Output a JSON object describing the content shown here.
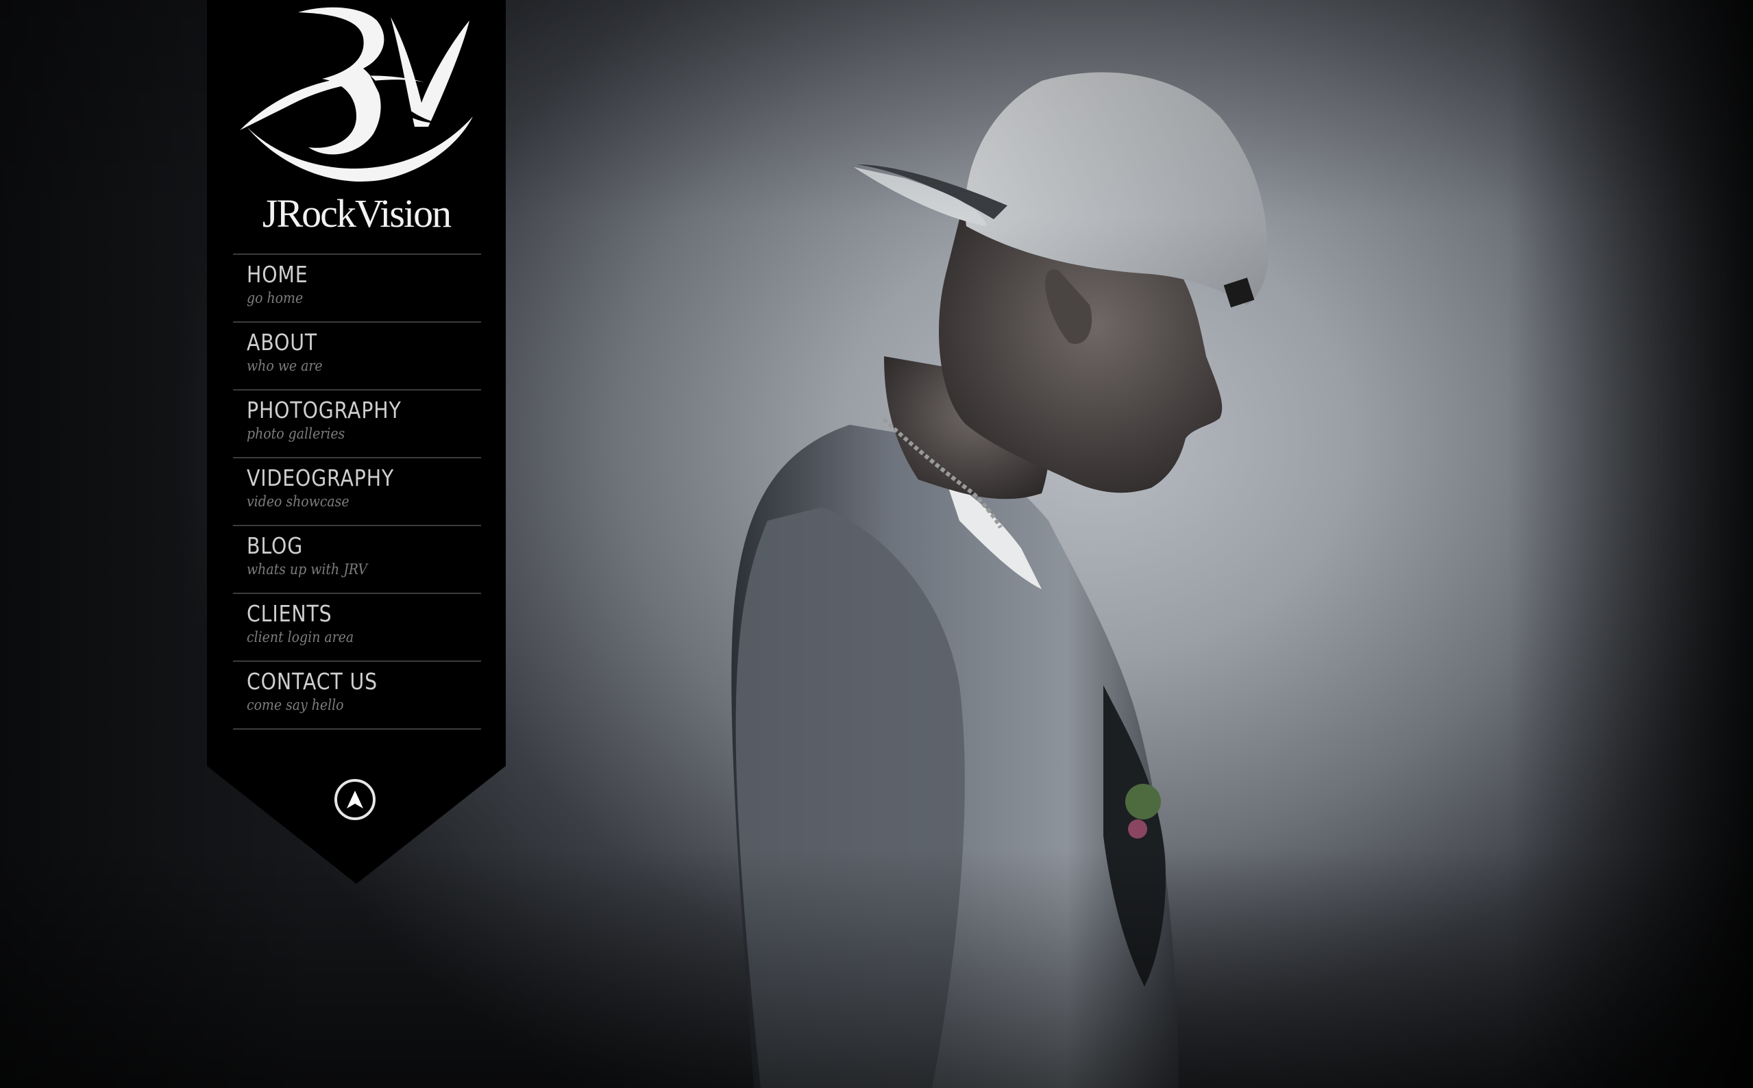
{
  "site": {
    "logo_monogram": "JRV",
    "brand_name": "JRockVision"
  },
  "nav": {
    "items": [
      {
        "label": "HOME",
        "sub": "go home"
      },
      {
        "label": "ABOUT",
        "sub": "who we are"
      },
      {
        "label": "PHOTOGRAPHY",
        "sub": "photo galleries"
      },
      {
        "label": "VIDEOGRAPHY",
        "sub": "video showcase"
      },
      {
        "label": "BLOG",
        "sub": "whats up with JRV"
      },
      {
        "label": "CLIENTS",
        "sub": "client login area"
      },
      {
        "label": "CONTACT US",
        "sub": "come say hello"
      }
    ],
    "up_icon": "navigation-arrow-icon"
  },
  "colors": {
    "banner_bg": "#000000",
    "menu_label": "#cfcfcf",
    "menu_sub": "#7d7d7d",
    "divider": "#3c3c3c"
  }
}
